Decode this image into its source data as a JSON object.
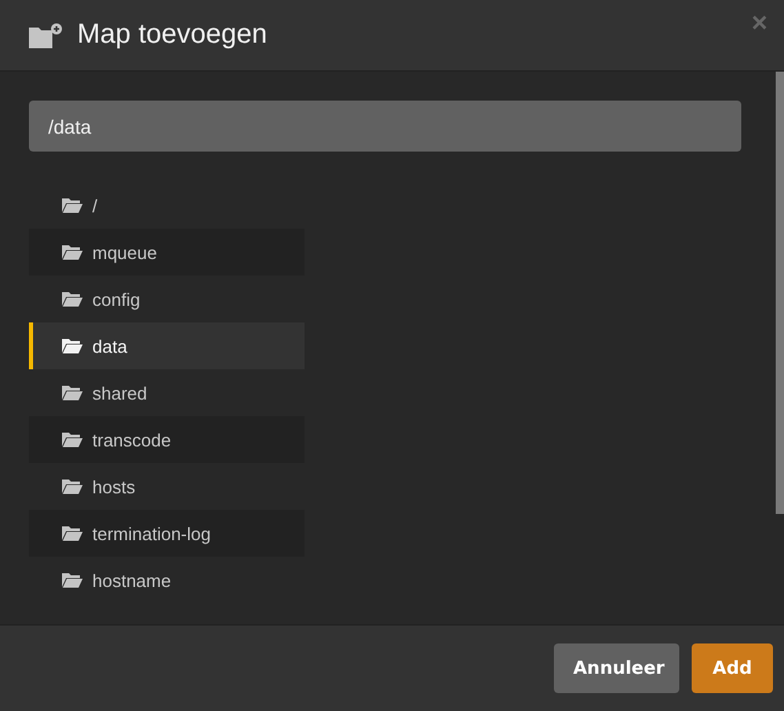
{
  "dialog": {
    "title": "Map toevoegen",
    "close": "×"
  },
  "path_field": {
    "value": "/data"
  },
  "folders": [
    {
      "name": "/",
      "selected": false
    },
    {
      "name": "mqueue",
      "selected": false
    },
    {
      "name": "config",
      "selected": false
    },
    {
      "name": "data",
      "selected": true
    },
    {
      "name": "shared",
      "selected": false
    },
    {
      "name": "transcode",
      "selected": false
    },
    {
      "name": "hosts",
      "selected": false
    },
    {
      "name": "termination-log",
      "selected": false
    },
    {
      "name": "hostname",
      "selected": false
    }
  ],
  "buttons": [
    {
      "label": "Annuleer",
      "kind": "secondary"
    },
    {
      "label": "Add",
      "kind": "primary"
    }
  ]
}
